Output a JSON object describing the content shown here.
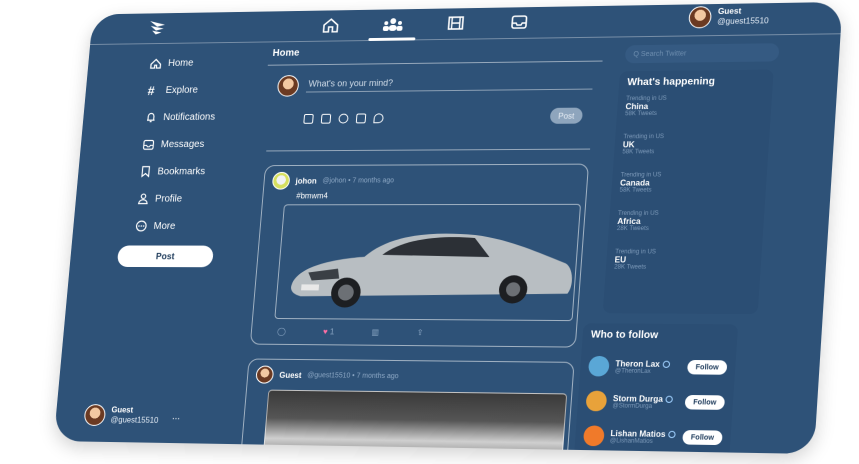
{
  "topbar": {
    "nav": [
      "home",
      "groups",
      "film",
      "inbox"
    ],
    "user": {
      "name": "Guest",
      "handle": "@guest15510"
    }
  },
  "sidebar": {
    "items": [
      {
        "label": "Home",
        "icon": "home-icon"
      },
      {
        "label": "Explore",
        "icon": "hash-icon"
      },
      {
        "label": "Notifications",
        "icon": "bell-icon"
      },
      {
        "label": "Messages",
        "icon": "inbox-icon"
      },
      {
        "label": "Bookmarks",
        "icon": "bookmark-icon"
      },
      {
        "label": "Profile",
        "icon": "person-icon"
      },
      {
        "label": "More",
        "icon": "more-circle-icon"
      }
    ],
    "post_label": "Post",
    "user": {
      "name": "Guest",
      "handle": "@guest15510",
      "more": "..."
    }
  },
  "main": {
    "title": "Home",
    "composer": {
      "placeholder": "What's on your mind?",
      "post_label": "Post"
    },
    "tweets": [
      {
        "name": "johon",
        "meta": "@johon • 7 months ago",
        "text": "#bmwm4",
        "likes": "1"
      },
      {
        "name": "Guest",
        "meta": "@guest15510 • 7 months ago",
        "text": ""
      }
    ]
  },
  "right": {
    "search_placeholder": "Q  Search Twitter",
    "happening_title": "What's happening",
    "trends": [
      {
        "category": "Trending in US",
        "topic": "China",
        "count": "58K Tweets"
      },
      {
        "category": "Trending in US",
        "topic": "UK",
        "count": "58K Tweets"
      },
      {
        "category": "Trending in US",
        "topic": "Canada",
        "count": "58K Tweets"
      },
      {
        "category": "Trending in US",
        "topic": "Africa",
        "count": "28K Tweets"
      },
      {
        "category": "Trending in US",
        "topic": "EU",
        "count": "28K Tweets"
      }
    ],
    "follow_title": "Who to follow",
    "follow": [
      {
        "name": "Theron Lax",
        "handle": "@TheronLax",
        "button": "Follow",
        "color": "#5aa7d6"
      },
      {
        "name": "Storm Durga",
        "handle": "@StormDurga",
        "button": "Follow",
        "color": "#e8a23a"
      },
      {
        "name": "Lishan Matios",
        "handle": "@LishanMatios",
        "button": "Follow",
        "color": "#f07a2a"
      }
    ]
  },
  "colors": {
    "background": "#2e5278",
    "panel": "#2b4e74",
    "accent": "#ffffff",
    "like": "#ff6fa5"
  }
}
